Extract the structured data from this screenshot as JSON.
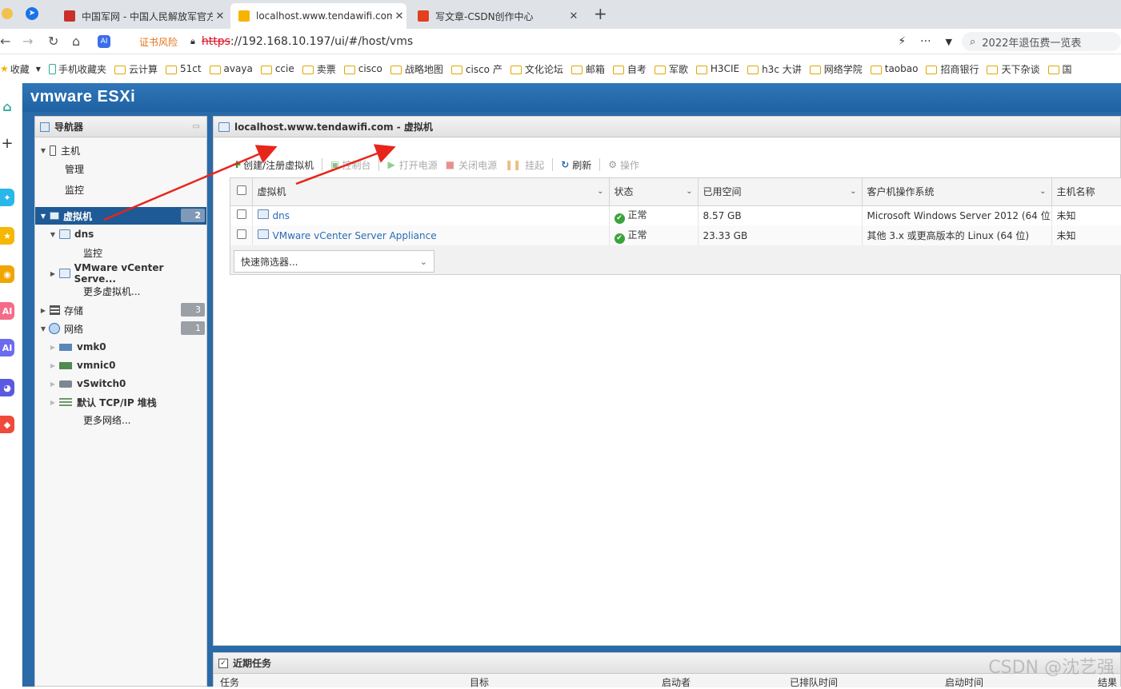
{
  "browser": {
    "tabs": [
      {
        "label": "中国军网 - 中国人民解放军官方",
        "active": false
      },
      {
        "label": "localhost.www.tendawifi.com",
        "active": true
      },
      {
        "label": "写文章-CSDN创作中心",
        "active": false
      }
    ],
    "new_tab": "+",
    "address": {
      "warning": "证书风险",
      "https": "https",
      "url": "://192.168.10.197/ui/#/host/vms"
    },
    "search_text": "2022年退伍费一览表",
    "bookmarks": [
      "收藏",
      "手机收藏夹",
      "云计算",
      "51ct",
      "avaya",
      "ccie",
      "卖票",
      "cisco",
      "战略地图",
      "cisco 产",
      "文化论坛",
      "邮箱",
      "自考",
      "军歌",
      "H3CIE",
      "h3c 大讲",
      "网络学院",
      "taobao",
      "招商银行",
      "天下杂谈",
      "国"
    ]
  },
  "esxi": {
    "logo": "vmware ESXi",
    "navigator": {
      "title": "导航器",
      "items": [
        {
          "label": "主机"
        },
        {
          "label": "管理"
        },
        {
          "label": "监控"
        },
        {
          "label": "虚拟机",
          "badge": "2"
        },
        {
          "label": "dns"
        },
        {
          "label": "监控"
        },
        {
          "label": "VMware vCenter Serve..."
        },
        {
          "label": "更多虚拟机..."
        },
        {
          "label": "存储",
          "badge": "3"
        },
        {
          "label": "网络",
          "badge": "1"
        },
        {
          "label": "vmk0"
        },
        {
          "label": "vmnic0"
        },
        {
          "label": "vSwitch0"
        },
        {
          "label": "默认 TCP/IP 堆栈"
        },
        {
          "label": "更多网络..."
        }
      ]
    },
    "main": {
      "title": "localhost.www.tendawifi.com - 虚拟机",
      "toolbar": {
        "create": "创建/注册虚拟机",
        "console": "控制台",
        "power_on": "打开电源",
        "power_off": "关闭电源",
        "suspend": "挂起",
        "refresh": "刷新",
        "actions": "操作"
      },
      "columns": [
        "虚拟机",
        "状态",
        "已用空间",
        "客户机操作系统",
        "主机名称"
      ],
      "rows": [
        {
          "name": "dns",
          "status": "正常",
          "space": "8.57 GB",
          "os": "Microsoft Windows Server 2012 (64 位)",
          "host": "未知"
        },
        {
          "name": "VMware vCenter Server Appliance",
          "status": "正常",
          "space": "23.33 GB",
          "os": "其他 3.x 或更高版本的 Linux (64 位)",
          "host": "未知"
        }
      ],
      "quick_filter": "快速筛选器..."
    },
    "tasks": {
      "title": "近期任务",
      "columns": [
        "任务",
        "目标",
        "启动者",
        "已排队时间",
        "启动时间",
        "结果"
      ]
    }
  },
  "watermark": "CSDN @沈艺强",
  "colors": {
    "esxi_blue": "#1f62a3",
    "selected": "#1e5a96",
    "annotation_arrow": "#e8251a",
    "ok_green": "#3aa33a"
  }
}
